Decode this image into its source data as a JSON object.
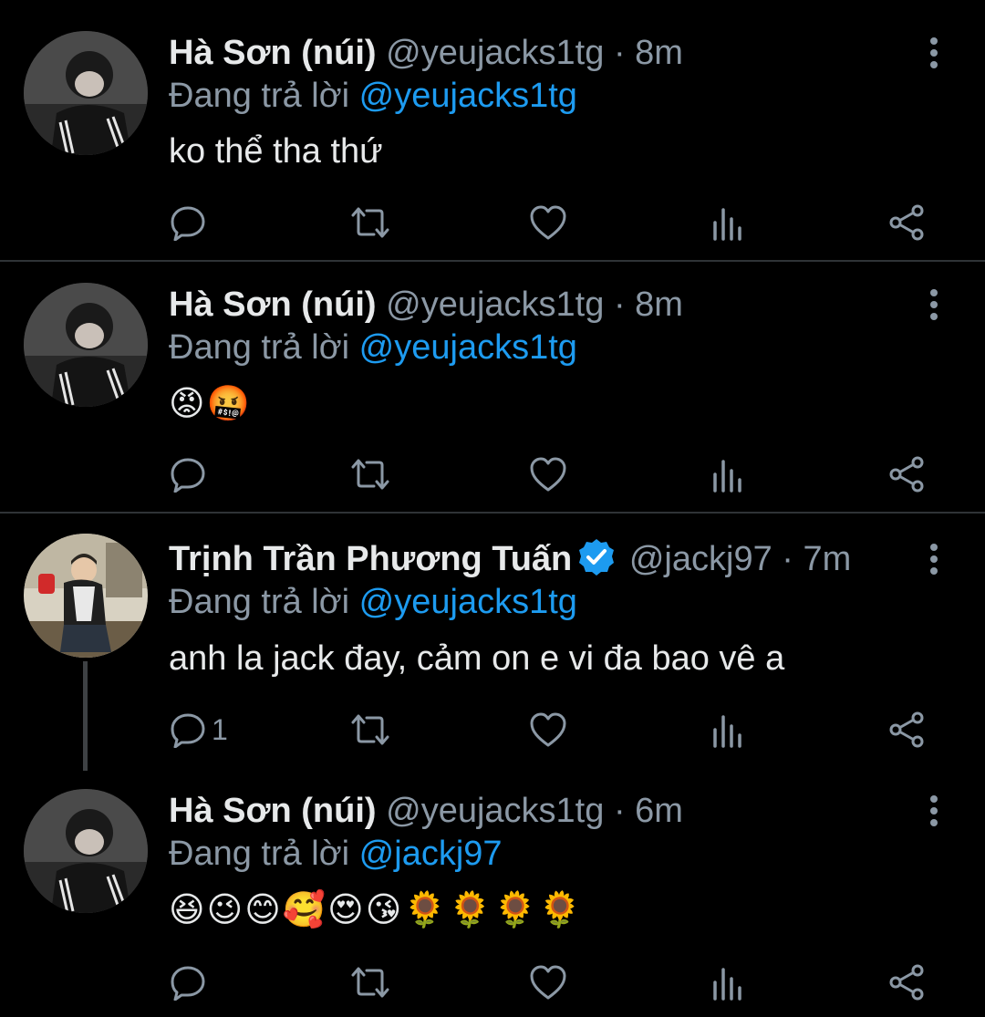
{
  "tweets": [
    {
      "author": {
        "name": "Hà Sơn (núi)",
        "handle": "@yeujacks1tg",
        "verified": false
      },
      "time": "8m",
      "reply_prefix": "Đang trả lời",
      "reply_to": "@yeujacks1tg",
      "text": "ko thể tha thứ",
      "reply_count": ""
    },
    {
      "author": {
        "name": "Hà Sơn (núi)",
        "handle": "@yeujacks1tg",
        "verified": false
      },
      "time": "8m",
      "reply_prefix": "Đang trả lời",
      "reply_to": "@yeujacks1tg",
      "text": "😡🤬",
      "reply_count": ""
    },
    {
      "author": {
        "name": "Trịnh Trần Phương Tuấn",
        "handle": "@jackj97",
        "verified": true
      },
      "time": "7m",
      "reply_prefix": "Đang trả lời",
      "reply_to": "@yeujacks1tg",
      "text": "anh la jack đay, cảm on e vi đa bao vê a",
      "reply_count": "1"
    },
    {
      "author": {
        "name": "Hà Sơn (núi)",
        "handle": "@yeujacks1tg",
        "verified": false
      },
      "time": "6m",
      "reply_prefix": "Đang trả lời",
      "reply_to": "@jackj97",
      "text": "😆😉😊🥰😍😘🌻🌻🌻🌻",
      "reply_count": ""
    }
  ],
  "separator": "·",
  "icons": {
    "reply": "reply-icon",
    "retweet": "retweet-icon",
    "like": "heart-icon",
    "analytics": "analytics-icon",
    "share": "share-icon",
    "menu": "more-vertical-icon",
    "verified": "verified-badge-icon"
  },
  "colors": {
    "background": "#000000",
    "text": "#e7e9ea",
    "secondary": "#8b98a5",
    "accent": "#1d9bf0",
    "divider": "#2f3336"
  }
}
